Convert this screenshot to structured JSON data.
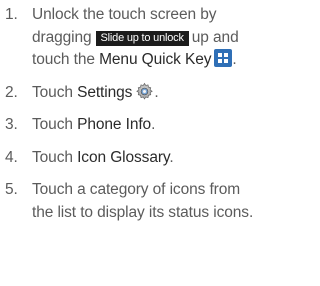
{
  "steps": [
    {
      "num": "1.",
      "pre": "Unlock the touch screen by dragging",
      "chip": "Slide up to unlock",
      "mid": "up and touch the",
      "keyword": "Menu Quick Key",
      "icon": "menu-quick-key-icon",
      "post": "."
    },
    {
      "num": "2.",
      "pre": "Touch",
      "keyword": "Settings",
      "icon": "settings-gear-icon",
      "post": "."
    },
    {
      "num": "3.",
      "pre": "Touch",
      "keyword": "Phone Info",
      "post": "."
    },
    {
      "num": "4.",
      "pre": "Touch",
      "keyword": "Icon Glossary",
      "post": "."
    },
    {
      "num": "5.",
      "text": "Touch a category of icons from the list to display its status icons."
    }
  ],
  "colors": {
    "body_text": "#5b5b5b",
    "keyword_text": "#2b2b2b",
    "chip_bg": "#1c1c1c",
    "chip_text": "#ffffff",
    "menu_key_blue": "#2f6fb6"
  }
}
